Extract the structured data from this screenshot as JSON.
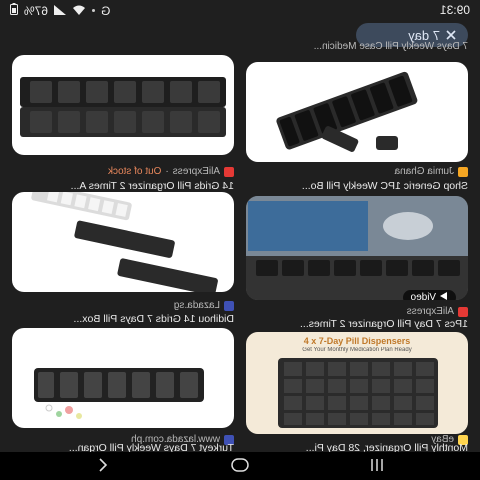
{
  "status_bar": {
    "time": "09:31",
    "battery": "67%",
    "brand_icon_letter": "G"
  },
  "filter_chip": {
    "label": "7 day",
    "icon": "close-icon"
  },
  "top_caption": "7 Days Weekly Pill Case Medicin...",
  "results": [
    {
      "title": "Shop Generic 1PC Weekly Pill Bo...",
      "source": "Jumia Ghana",
      "fav_color": "#f5a623",
      "status": "",
      "has_video": false
    },
    {
      "title": "14 Grids Pill Organizer 2 Times A...",
      "source": "AliExpress",
      "fav_color": "#e53935",
      "status": "Out of stock",
      "has_video": false
    },
    {
      "title": "1Pcs 7 Day Pill Organizer 2 Times...",
      "source": "AliExpress",
      "fav_color": "#e53935",
      "status": "",
      "has_video": true,
      "video_label": "Video"
    },
    {
      "title": "Didihou 14 Grids 7 Days Pill Box...",
      "source": "Lazada.sg",
      "fav_color": "#3f51b5",
      "status": "",
      "has_video": false
    },
    {
      "title": "Monthly Pill Organizer, 28 Day Pi...",
      "source": "eBay",
      "fav_color": "#ffd54f",
      "status": "",
      "has_video": false
    },
    {
      "title": "Turkeyt 7 Days Weekly Pill Organ...",
      "source": "www.lazada.com.ph",
      "fav_color": "#3f51b5",
      "status": "",
      "has_video": false
    }
  ],
  "product_banner": {
    "headline": "4 x 7-Day Pill Dispensers",
    "sub": "Get Your Monthly Medication Plan Ready"
  },
  "colors": {
    "background": "#1f1f1f",
    "chip_bg": "#3d4a5c",
    "out_of_stock": "#e8875c",
    "organizer_dark": "#2a2a2a"
  }
}
